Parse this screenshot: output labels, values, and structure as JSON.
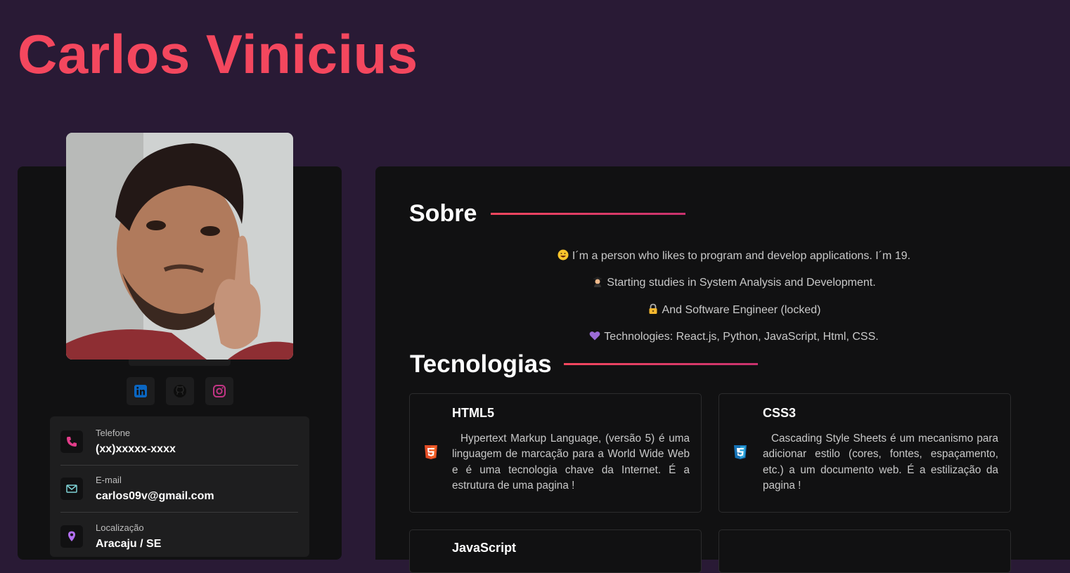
{
  "header": {
    "name": "Carlos Vinicius"
  },
  "profile": {
    "photo_alt": "Carlos Vinicius profile photo",
    "socials": [
      {
        "icon": "linkedin-icon",
        "color": "#0a66c2"
      },
      {
        "icon": "github-icon",
        "color": "#111111"
      },
      {
        "icon": "instagram-icon",
        "color": "#c13584"
      }
    ],
    "contacts": [
      {
        "label": "Telefone",
        "value": "(xx)xxxxx-xxxx",
        "icon": "phone-icon",
        "color": "#e33d8a"
      },
      {
        "label": "E-mail",
        "value": "carlos09v@gmail.com",
        "icon": "mail-icon",
        "color": "#7fd3d6"
      },
      {
        "label": "Localização",
        "value": "Aracaju / SE",
        "icon": "location-icon",
        "color": "#b16ef0"
      }
    ]
  },
  "sobre": {
    "title": "Sobre",
    "lines": [
      {
        "emoji": "grinning-face-icon",
        "text": "I´m a person who likes to program and develop applications. I´m 19."
      },
      {
        "emoji": "student-icon",
        "text": "Starting studies in System Analysis and Development."
      },
      {
        "emoji": "lock-icon",
        "text": "And Software Engineer (locked)"
      },
      {
        "emoji": "purple-heart-icon",
        "text": "Technologies: React.js, Python, JavaScript, Html, CSS."
      }
    ]
  },
  "tecnologias": {
    "title": "Tecnologias",
    "cards": [
      {
        "name": "HTML5",
        "icon": "html5-icon",
        "color": "#e44d26",
        "description": "Hypertext Markup Language, (versão 5) é uma linguagem de marcação para a World Wide Web e é uma tecnologia chave da Internet. É a estrutura de uma pagina !"
      },
      {
        "name": "CSS3",
        "icon": "css3-icon",
        "color": "#1572b6",
        "description": "Cascading Style Sheets é um mecanismo para adicionar estilo (cores, fontes, espaçamento, etc.) a um documento web. É a estilização da pagina !"
      },
      {
        "name": "JavaScript",
        "icon": "javascript-icon",
        "color": "#f7df1e",
        "description": ""
      }
    ]
  },
  "colors": {
    "accent": "#f4475e",
    "background": "#291a35",
    "panel": "#111112"
  }
}
